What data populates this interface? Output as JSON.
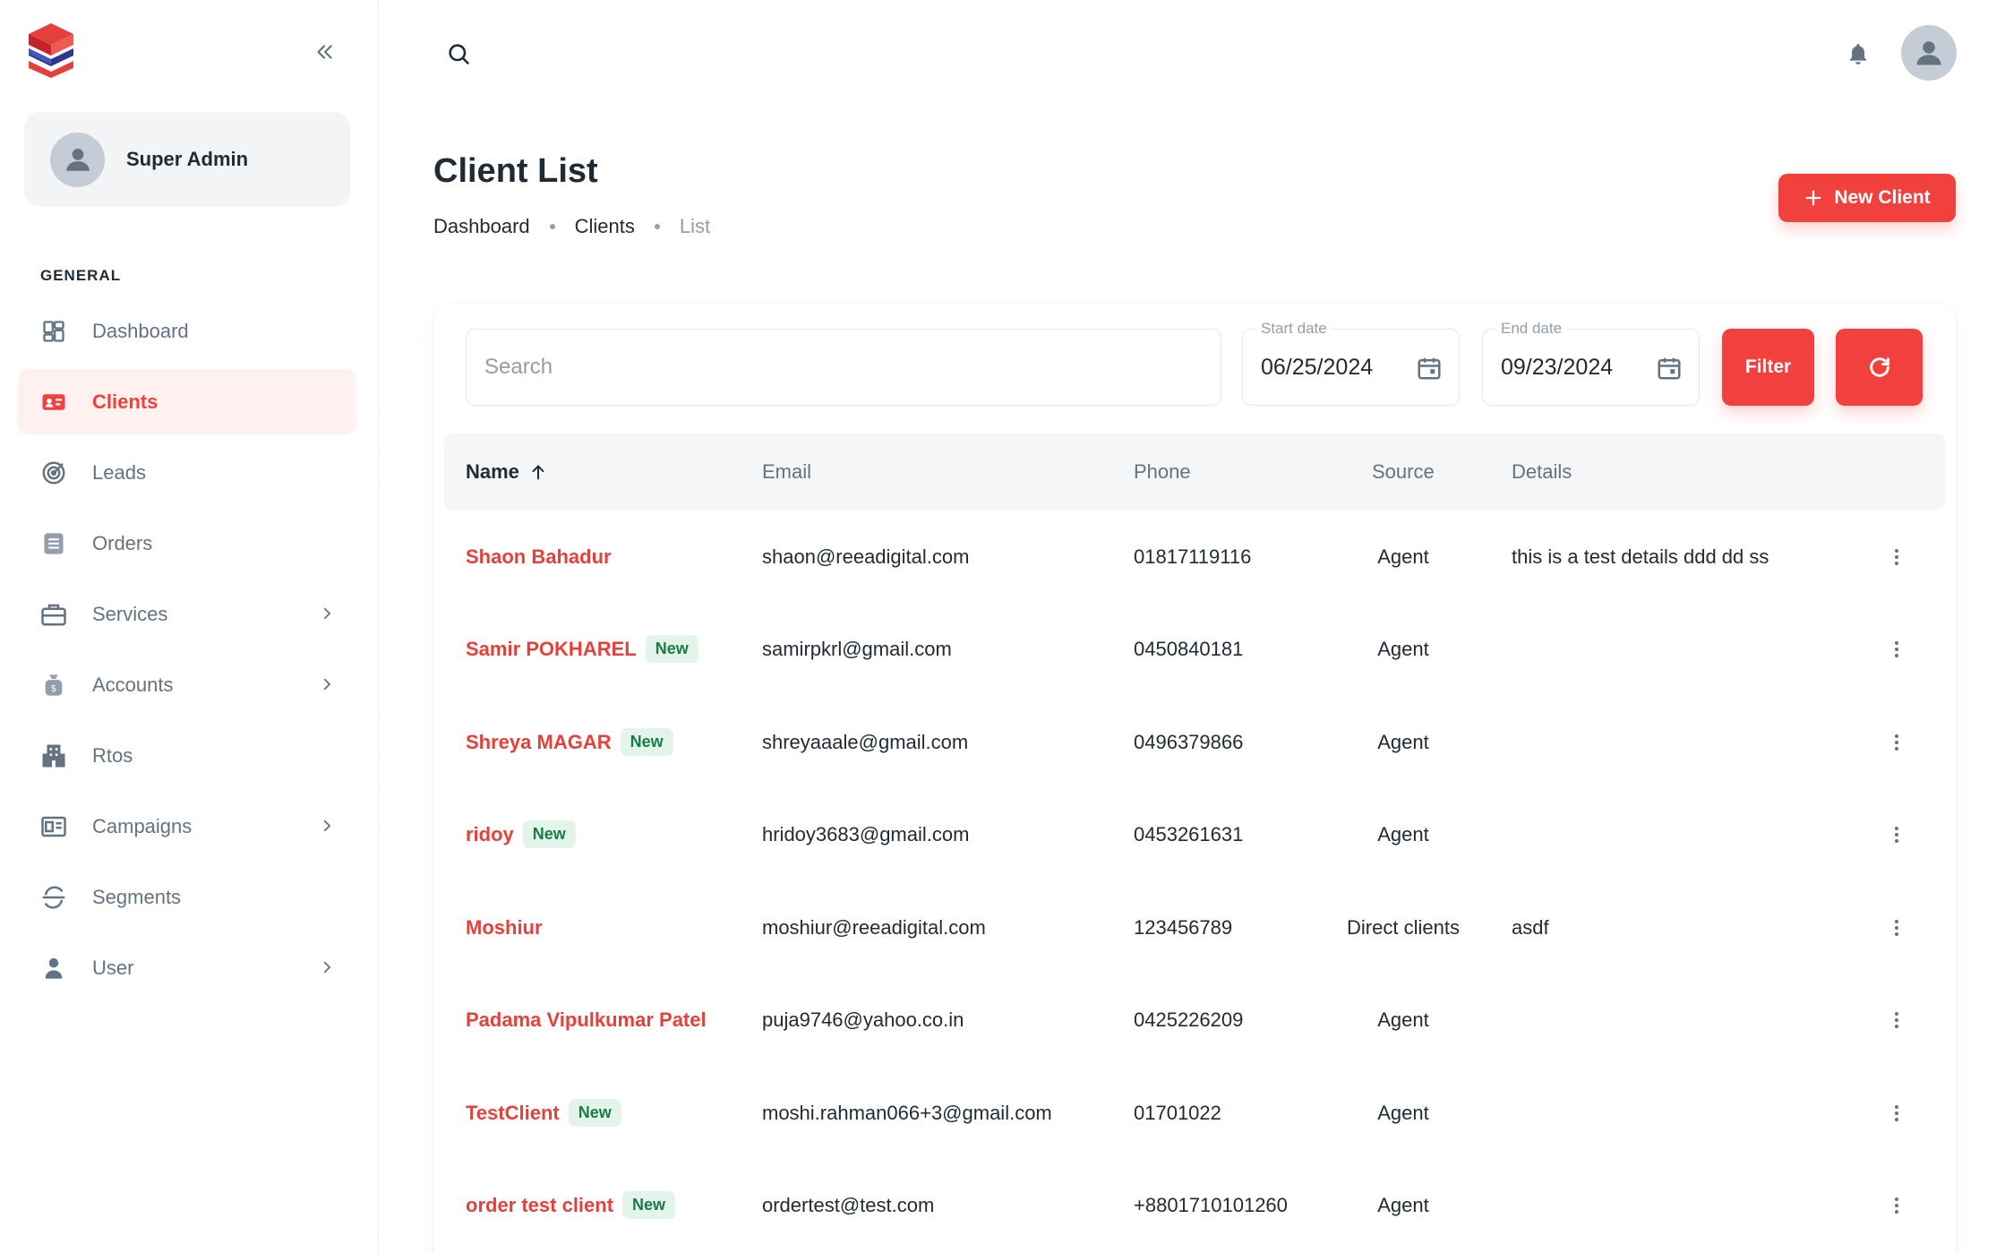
{
  "colors": {
    "accent": "#f2413c",
    "badge_bg": "#e3f5ea",
    "badge_text": "#1b7a45"
  },
  "sidebar": {
    "account_name": "Super Admin",
    "section_label": "GENERAL",
    "items": [
      {
        "label": "Dashboard",
        "icon": "dashboard-icon",
        "active": false,
        "has_children": false
      },
      {
        "label": "Clients",
        "icon": "client-card-icon",
        "active": true,
        "has_children": false
      },
      {
        "label": "Leads",
        "icon": "target-icon",
        "active": false,
        "has_children": false
      },
      {
        "label": "Orders",
        "icon": "orders-list-icon",
        "active": false,
        "has_children": false
      },
      {
        "label": "Services",
        "icon": "briefcase-icon",
        "active": false,
        "has_children": true
      },
      {
        "label": "Accounts",
        "icon": "money-bag-icon",
        "active": false,
        "has_children": true
      },
      {
        "label": "Rtos",
        "icon": "building-icon",
        "active": false,
        "has_children": false
      },
      {
        "label": "Campaigns",
        "icon": "campaign-icon",
        "active": false,
        "has_children": true
      },
      {
        "label": "Segments",
        "icon": "segments-icon",
        "active": false,
        "has_children": false
      },
      {
        "label": "User",
        "icon": "user-icon",
        "active": false,
        "has_children": true
      }
    ]
  },
  "page": {
    "title": "Client List",
    "breadcrumb": [
      "Dashboard",
      "Clients",
      "List"
    ],
    "new_button_label": "New Client"
  },
  "filters": {
    "search_placeholder": "Search",
    "start_label": "Start date",
    "start_value": "06/25/2024",
    "end_label": "End date",
    "end_value": "09/23/2024",
    "filter_label": "Filter"
  },
  "table": {
    "columns": [
      "Name",
      "Email",
      "Phone",
      "Source",
      "Details"
    ],
    "rows": [
      {
        "name": "Shaon Bahadur",
        "badge": "",
        "email": "shaon@reeadigital.com",
        "phone": "01817119116",
        "source": "Agent",
        "details": "this is a test details ddd dd ss"
      },
      {
        "name": "Samir POKHAREL",
        "badge": "New",
        "email": "samirpkrl@gmail.com",
        "phone": "0450840181",
        "source": "Agent",
        "details": ""
      },
      {
        "name": "Shreya MAGAR",
        "badge": "New",
        "email": "shreyaaale@gmail.com",
        "phone": "0496379866",
        "source": "Agent",
        "details": ""
      },
      {
        "name": "ridoy",
        "badge": "New",
        "email": "hridoy3683@gmail.com",
        "phone": "0453261631",
        "source": "Agent",
        "details": ""
      },
      {
        "name": "Moshiur",
        "badge": "",
        "email": "moshiur@reeadigital.com",
        "phone": "123456789",
        "source": "Direct clients",
        "details": "asdf"
      },
      {
        "name": "Padama Vipulkumar Patel",
        "badge": "",
        "email": "puja9746@yahoo.co.in",
        "phone": "0425226209",
        "source": "Agent",
        "details": ""
      },
      {
        "name": "TestClient",
        "badge": "New",
        "email": "moshi.rahman066+3@gmail.com",
        "phone": "01701022",
        "source": "Agent",
        "details": ""
      },
      {
        "name": "order test client",
        "badge": "New",
        "email": "ordertest@test.com",
        "phone": "+8801710101260",
        "source": "Agent",
        "details": ""
      }
    ]
  }
}
